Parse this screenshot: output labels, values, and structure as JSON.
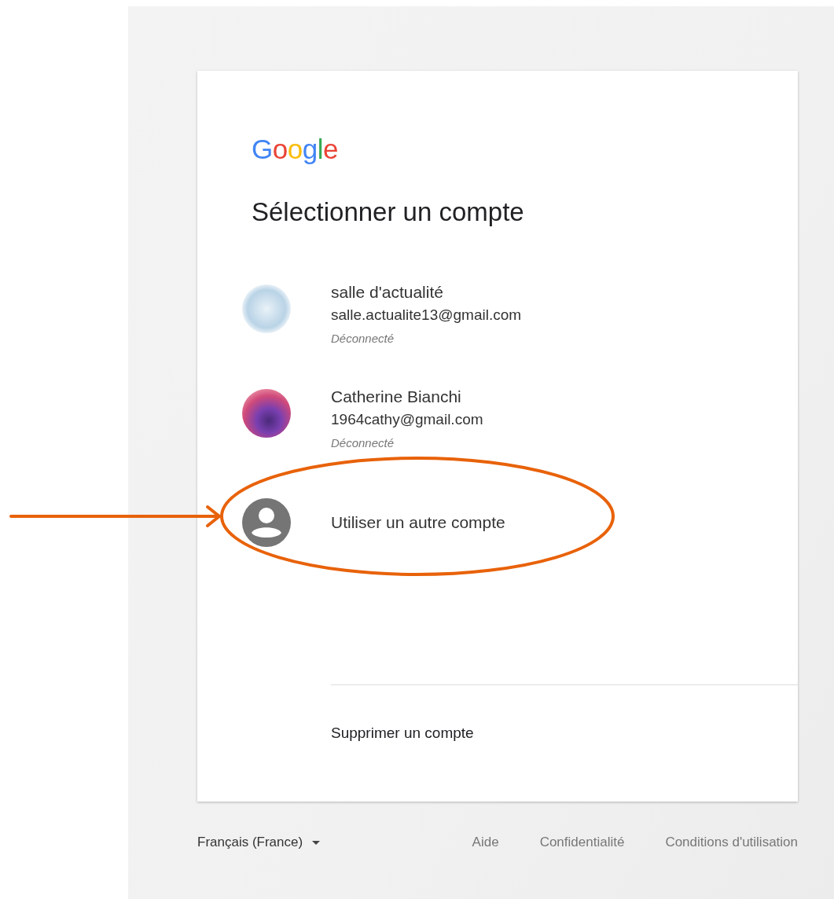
{
  "logo": {
    "text": "Google"
  },
  "title": "Sélectionner un compte",
  "accounts": [
    {
      "name": "salle d'actualité",
      "email": "salle.actualite13@gmail.com",
      "status": "Déconnecté"
    },
    {
      "name": "Catherine Bianchi",
      "email": "1964cathy@gmail.com",
      "status": "Déconnecté"
    }
  ],
  "other_account": {
    "label": "Utiliser un autre compte"
  },
  "remove_account": {
    "label": "Supprimer un compte"
  },
  "footer": {
    "language": "Français (France)",
    "links": [
      "Aide",
      "Confidentialité",
      "Conditions d'utilisation"
    ]
  }
}
